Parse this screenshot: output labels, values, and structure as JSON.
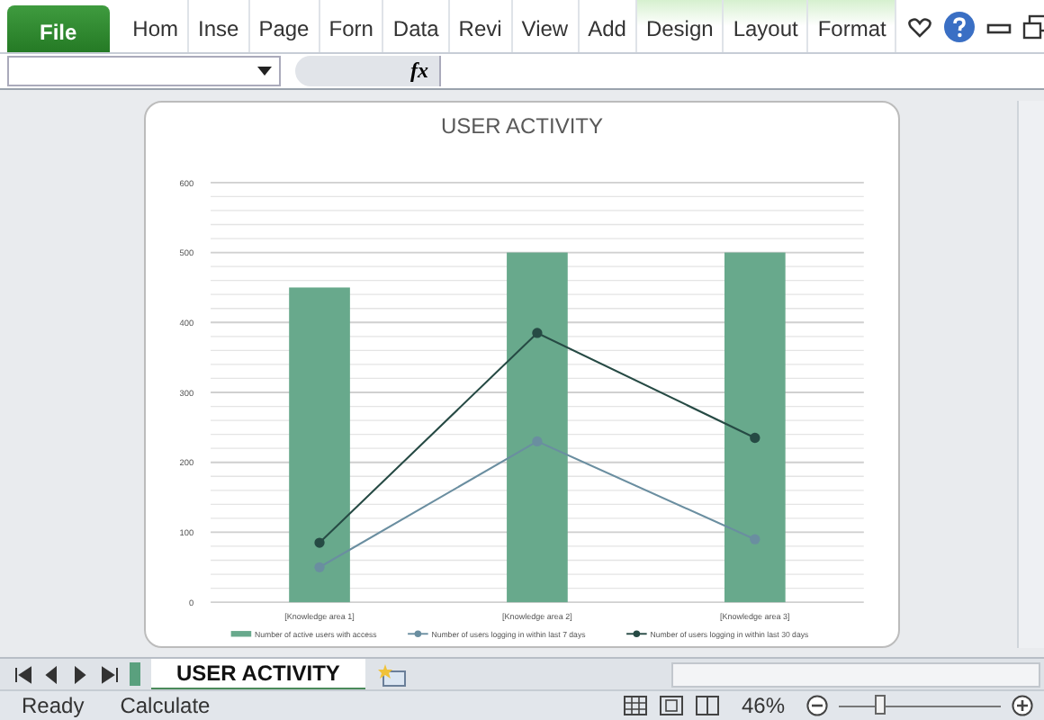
{
  "ribbon": {
    "tabs": [
      {
        "label": "File",
        "kind": "file"
      },
      {
        "label": "Hom",
        "kind": "normal"
      },
      {
        "label": "Inse",
        "kind": "normal"
      },
      {
        "label": "Page",
        "kind": "normal"
      },
      {
        "label": "Forn",
        "kind": "normal"
      },
      {
        "label": "Data",
        "kind": "normal"
      },
      {
        "label": "Revi",
        "kind": "normal"
      },
      {
        "label": "View",
        "kind": "normal"
      },
      {
        "label": "Add",
        "kind": "normal"
      },
      {
        "label": "Design",
        "kind": "contextual"
      },
      {
        "label": "Layout",
        "kind": "contextual"
      },
      {
        "label": "Format",
        "kind": "contextual"
      }
    ]
  },
  "formula_bar": {
    "fx": "fx"
  },
  "chart": {
    "chart_data": {
      "type": "bar",
      "title": "USER ACTIVITY",
      "categories": [
        "[Knowledge area 1]",
        "[Knowledge area 2]",
        "[Knowledge area 3]"
      ],
      "ylim": [
        0,
        600
      ],
      "yticks": [
        0,
        100,
        200,
        300,
        400,
        500,
        600
      ],
      "grid": true,
      "legend": true,
      "series": [
        {
          "name": "Number of active users with access",
          "color": "#68a98c",
          "values": [
            450,
            500,
            500
          ]
        },
        {
          "name": "Number of users logging in within last 7 days",
          "type": "line",
          "marker": "circle",
          "color": "#6a8ea0",
          "values": [
            50,
            230,
            90
          ]
        },
        {
          "name": "Number of users logging in within last 30 days",
          "type": "line",
          "marker": "circle",
          "color": "#264a44",
          "values": [
            85,
            385,
            235
          ]
        }
      ]
    }
  },
  "sheet_tabs": [
    {
      "label": "USER ACTIVITY",
      "selected": true
    }
  ],
  "status_bar": {
    "items": [
      "Ready",
      "Calculate"
    ],
    "zoom": "46%",
    "zoom_level": {
      "level": 0.25
    }
  }
}
